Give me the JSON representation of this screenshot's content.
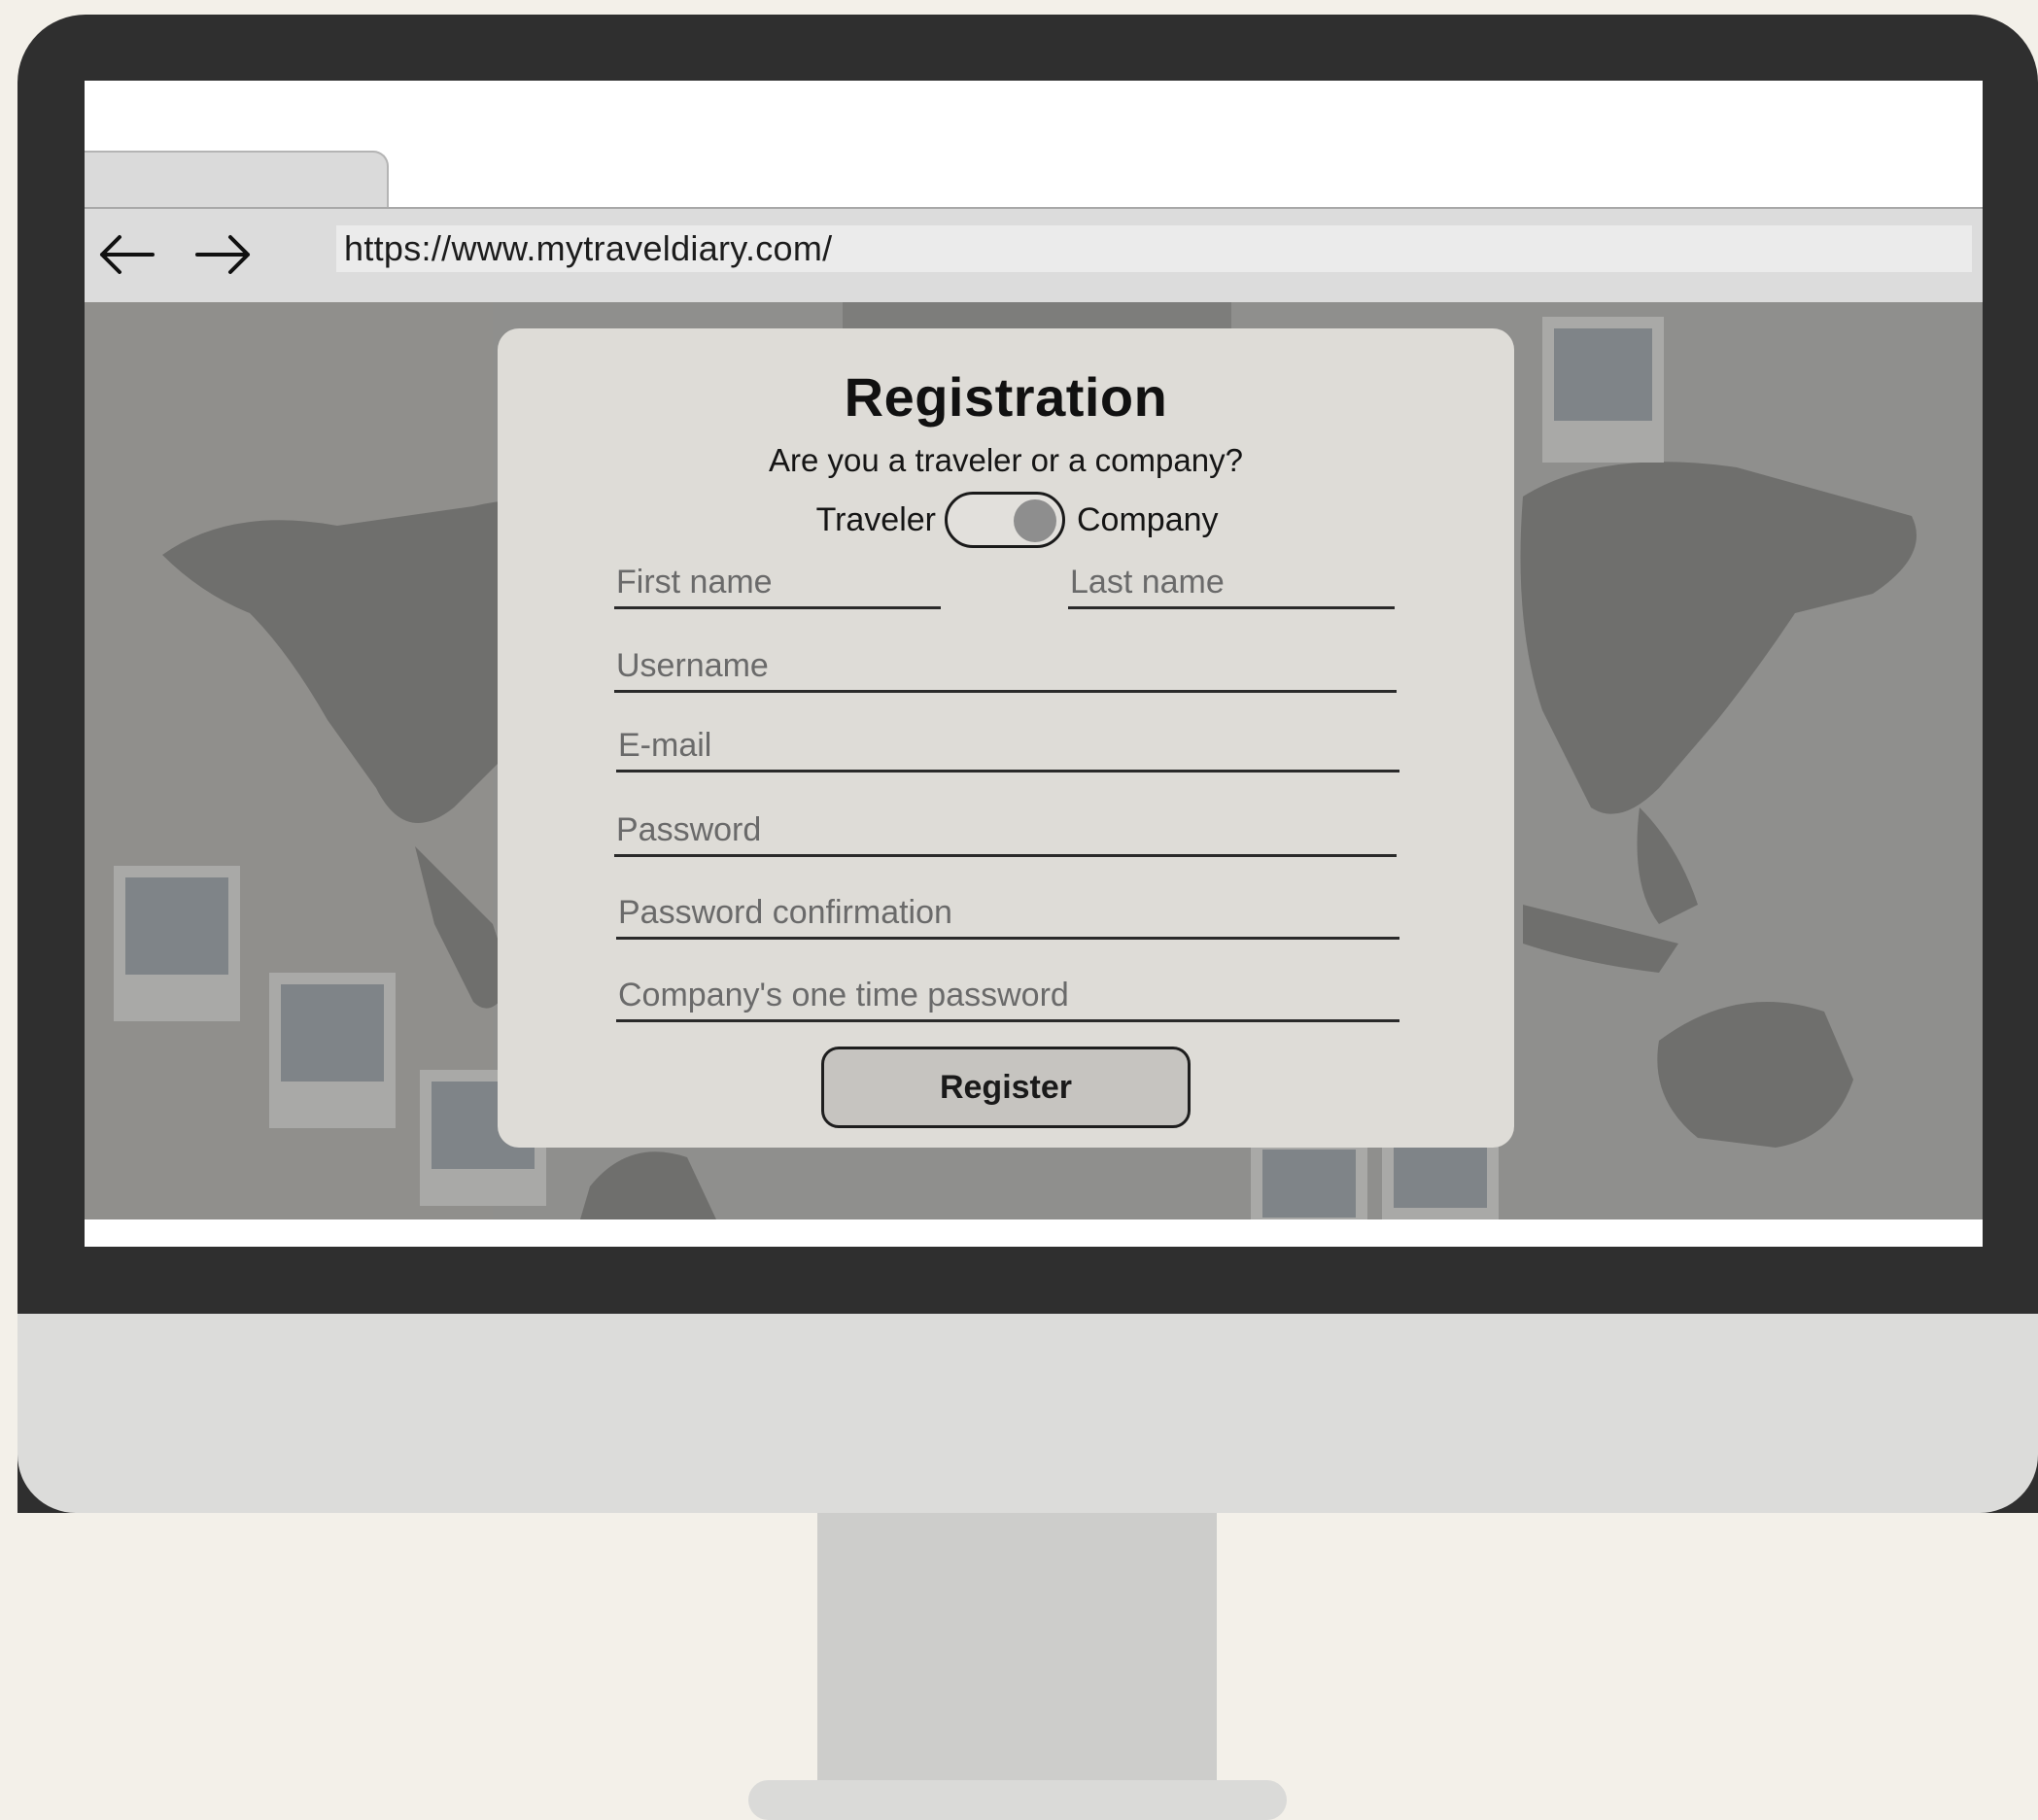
{
  "browser": {
    "url": "https://www.mytraveldiary.com/"
  },
  "registration": {
    "title": "Registration",
    "question": "Are you a traveler or a company?",
    "toggle": {
      "left_label": "Traveler",
      "right_label": "Company",
      "selected": "Company"
    },
    "fields": {
      "first_name": "First name",
      "last_name": "Last name",
      "username": "Username",
      "email": "E-mail",
      "password": "Password",
      "password_confirmation": "Password confirmation",
      "company_otp": "Company's one time password"
    },
    "register_label": "Register"
  },
  "icons": {
    "back": "arrow-left-icon",
    "forward": "arrow-right-icon"
  },
  "colors": {
    "overlay": "#8c8c8a",
    "card": "#dedcd7",
    "button": "#c6c4c0",
    "bezel": "#2f2f2f"
  }
}
